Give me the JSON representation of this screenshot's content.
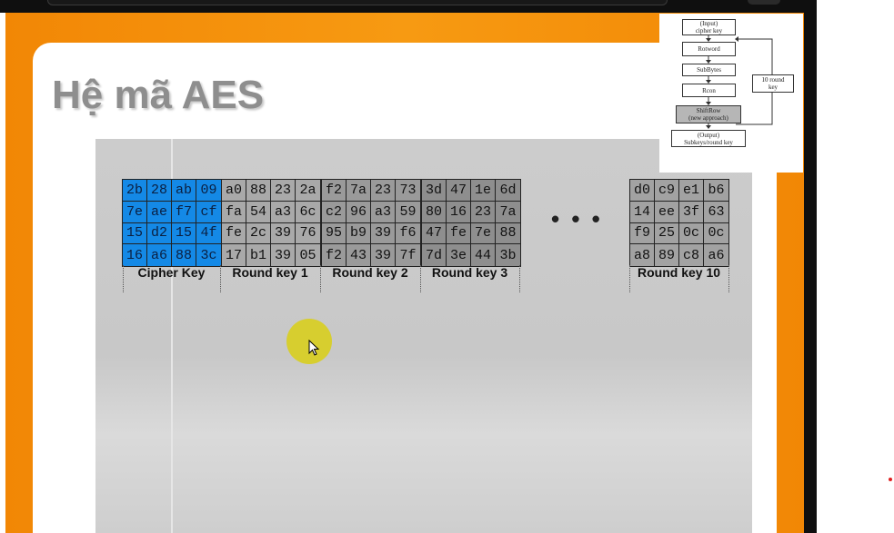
{
  "slide": {
    "title": "Hệ mã AES"
  },
  "keys": [
    {
      "label": "Cipher Key",
      "rows": [
        [
          "2b",
          "28",
          "ab",
          "09"
        ],
        [
          "7e",
          "ae",
          "f7",
          "cf"
        ],
        [
          "15",
          "d2",
          "15",
          "4f"
        ],
        [
          "16",
          "a6",
          "88",
          "3c"
        ]
      ]
    },
    {
      "label": "Round key 1",
      "rows": [
        [
          "a0",
          "88",
          "23",
          "2a"
        ],
        [
          "fa",
          "54",
          "a3",
          "6c"
        ],
        [
          "fe",
          "2c",
          "39",
          "76"
        ],
        [
          "17",
          "b1",
          "39",
          "05"
        ]
      ]
    },
    {
      "label": "Round key 2",
      "rows": [
        [
          "f2",
          "7a",
          "23",
          "73"
        ],
        [
          "c2",
          "96",
          "a3",
          "59"
        ],
        [
          "95",
          "b9",
          "39",
          "f6"
        ],
        [
          "f2",
          "43",
          "39",
          "7f"
        ]
      ]
    },
    {
      "label": "Round key 3",
      "rows": [
        [
          "3d",
          "47",
          "1e",
          "6d"
        ],
        [
          "80",
          "16",
          "23",
          "7a"
        ],
        [
          "47",
          "fe",
          "7e",
          "88"
        ],
        [
          "7d",
          "3e",
          "44",
          "3b"
        ]
      ]
    },
    {
      "label": "Round key 10",
      "rows": [
        [
          "d0",
          "c9",
          "e1",
          "b6"
        ],
        [
          "14",
          "ee",
          "3f",
          "63"
        ],
        [
          "f9",
          "25",
          "0c",
          "0c"
        ],
        [
          "a8",
          "89",
          "c8",
          "a6"
        ]
      ]
    }
  ],
  "ellipsis": "• • •",
  "flowchart": {
    "input": [
      "(Input)",
      "cipher key"
    ],
    "rotword": "Rotword",
    "subbytes": "SubBytes",
    "rcon": "Rcon",
    "shiftrow": [
      "ShiftRow",
      "(new approach)"
    ],
    "output": [
      "(Output)",
      "Subkeys/round key"
    ],
    "loop": [
      "10 round",
      "key"
    ]
  },
  "colors": {
    "orange": "#f28705",
    "cipher_key_blue": "#1489e6",
    "cursor_highlight": "#d8ce1e"
  }
}
